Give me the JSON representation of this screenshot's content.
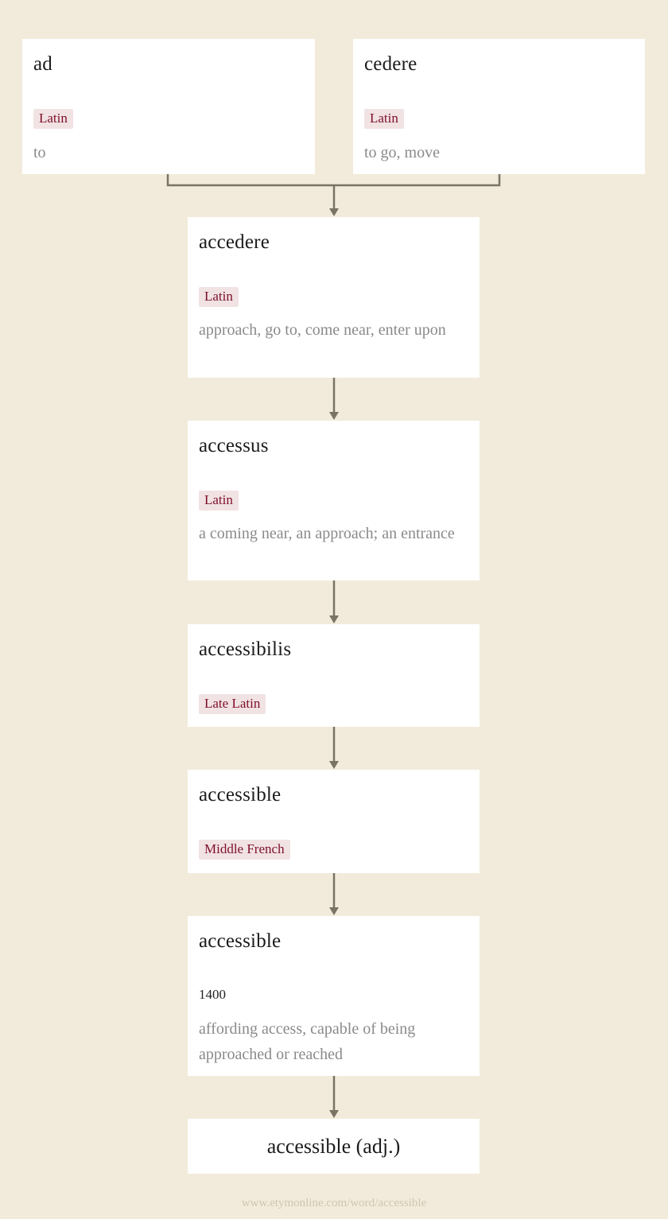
{
  "colors": {
    "background": "#f2ebdb",
    "card": "#ffffff",
    "language_badge_bg": "#f1e2e4",
    "language_badge_text": "#7e1029",
    "gloss_text": "#8a8a8a",
    "connector": "#7a7466"
  },
  "sources": [
    {
      "word": "ad",
      "language": "Latin",
      "gloss": "to"
    },
    {
      "word": "cedere",
      "language": "Latin",
      "gloss": "to go, move"
    }
  ],
  "chain": [
    {
      "word": "accedere",
      "language": "Latin",
      "gloss": "approach, go to, come near, enter upon"
    },
    {
      "word": "accessus",
      "language": "Latin",
      "gloss": "a coming near, an approach; an entrance"
    },
    {
      "word": "accessibilis",
      "language": "Late Latin"
    },
    {
      "word": "accessible",
      "language": "Middle French"
    },
    {
      "word": "accessible",
      "year": "1400",
      "gloss": "affording access, capable of being approached or reached"
    }
  ],
  "result": {
    "word": "accessible (adj.)"
  },
  "footer": {
    "url": "www.etymonline.com/word/accessible"
  }
}
